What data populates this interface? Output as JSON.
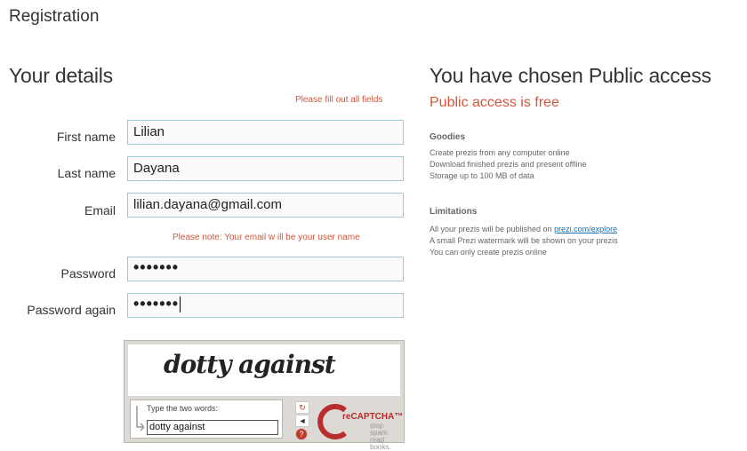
{
  "page": {
    "title": "Registration"
  },
  "details": {
    "heading": "Your details",
    "required_note": "Please fill out all fields",
    "fields": {
      "first_name": {
        "label": "First name",
        "value": "Lilian"
      },
      "last_name": {
        "label": "Last name",
        "value": "Dayana"
      },
      "email": {
        "label": "Email",
        "value": "lilian.dayana@gmail.com"
      },
      "email_note": "Please note: Your email w   ill be your user name",
      "password": {
        "label": "Password",
        "value": "•••••••"
      },
      "password_again": {
        "label": "Password again",
        "value": "•••••••"
      }
    }
  },
  "captcha": {
    "words": "dotty   against",
    "prompt": "Type the two words:",
    "input_value": "dotty  against",
    "reload_icon": "↻",
    "audio_icon": "◄",
    "help_icon": "?",
    "brand": "reCAPTCHA™",
    "tagline_1": "stop spam.",
    "tagline_2": "read books."
  },
  "access": {
    "heading": "You have chosen Public access",
    "price": "Public access is free",
    "goodies": {
      "title": "Goodies",
      "items": [
        "Create prezis from any computer online",
        "Download finished prezis and present offline",
        "Storage up to 100 MB of data"
      ]
    },
    "limitations": {
      "title": "Limitations",
      "items_prefix": "All your prezis will be published on ",
      "items_link": "prezi.com/explore",
      "items": [
        "A small Prezi watermark will be shown on your prezis",
        "You can only create prezis online"
      ]
    }
  },
  "colors": {
    "accent": "#d2553b",
    "link": "#1a6fb0",
    "field_border": "#9dc8e0"
  }
}
